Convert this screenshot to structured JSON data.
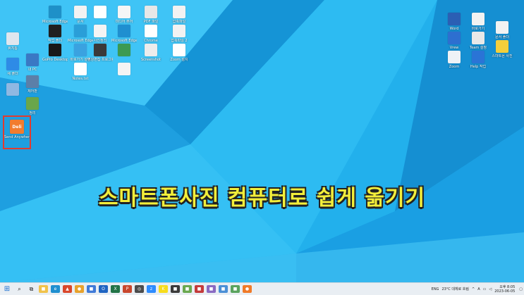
{
  "desktop": {
    "icons_left": [
      {
        "label": "휴지통",
        "color": "#dfe6ee",
        "icon": "recycle-bin-icon"
      },
      {
        "label": "새 폴더",
        "color": "#2e8be6",
        "icon": "folder-icon"
      },
      {
        "label": "",
        "color": "#8fb8e2",
        "icon": "cloud-icon"
      }
    ],
    "icons_col2": [
      {
        "label": "내 PC",
        "color": "#3a78c4",
        "icon": "pc-icon"
      },
      {
        "label": "제어판",
        "color": "#5c7fa8",
        "icon": "control-panel-icon"
      },
      {
        "label": "정리",
        "color": "#6aa64a",
        "icon": "tool-icon"
      }
    ],
    "icons_col3": [
      {
        "label": "Microsoft Edge",
        "color": "#1e90c8",
        "icon": "edge-icon"
      },
      {
        "label": "작업 폴더",
        "color": "#202020",
        "icon": "app-icon"
      },
      {
        "label": "GoPro Desktop",
        "color": "#181818",
        "icon": "camera-icon"
      }
    ],
    "icons_col4": [
      {
        "label": "문서",
        "color": "#f2f2f2",
        "icon": "document-icon"
      },
      {
        "label": "Microsoft Edge",
        "color": "#2a9ed8",
        "icon": "edge-icon"
      },
      {
        "label": "바로가기 설정",
        "color": "#3aa2e0",
        "icon": "edge-icon"
      },
      {
        "label": "Notes.txt",
        "color": "#ffffff",
        "icon": "text-file-icon"
      }
    ],
    "icons_col5": [
      {
        "label": "",
        "color": "#ffffff",
        "icon": "file-icon"
      },
      {
        "label": "사진정리",
        "color": "#f4f4f4",
        "icon": "document-icon"
      },
      {
        "label": "영상편집 프로그램",
        "color": "#3a3a3a",
        "icon": "video-icon"
      }
    ],
    "icons_col6": [
      {
        "label": "미디어 뷰어",
        "color": "#f6f6f6",
        "icon": "document-icon"
      },
      {
        "label": "Microsoft Edge",
        "color": "#1f8fd0",
        "icon": "edge-icon"
      },
      {
        "label": "",
        "color": "#3c9a52",
        "icon": "app-icon"
      },
      {
        "label": "",
        "color": "#f4f4f4",
        "icon": "zip-icon"
      }
    ],
    "icons_col7": [
      {
        "label": "PDF 파일",
        "color": "#e7e7e7",
        "icon": "pdf-icon"
      },
      {
        "label": "Chrome",
        "color": "#ffffff",
        "icon": "chrome-icon"
      },
      {
        "label": "Screenshot",
        "color": "#ececec",
        "icon": "image-icon"
      }
    ],
    "icons_col8": [
      {
        "label": "압축파일",
        "color": "#f2f2f2",
        "icon": "zip-icon"
      },
      {
        "label": "압축파일 2",
        "color": "#f2f2f2",
        "icon": "zip-icon"
      },
      {
        "label": "Zoom 설치",
        "color": "#ffffff",
        "icon": "file-icon"
      }
    ],
    "icons_right": [
      {
        "label": "Word",
        "color": "#2b5fb4",
        "icon": "word-icon"
      },
      {
        "label": "Vrew",
        "color": "#2d6fd0",
        "icon": "vrew-icon"
      },
      {
        "label": "Zoom",
        "color": "#eef2f6",
        "icon": "zoom-icon"
      }
    ],
    "icons_right2": [
      {
        "label": "바로가기",
        "color": "#f2f2f2",
        "icon": "document-icon"
      },
      {
        "label": "Team 설정",
        "color": "#e8e8e8",
        "icon": "document-icon"
      },
      {
        "label": "Help 작업",
        "color": "#2a74d6",
        "icon": "help-icon"
      }
    ],
    "icons_right3": [
      {
        "label": "문서 폴더",
        "color": "#f2f2f2",
        "icon": "document-icon"
      },
      {
        "label": "스마트폰 사진",
        "color": "#f4cf3b",
        "icon": "folder-icon"
      }
    ],
    "selected_icon": {
      "label": "Send Anywhere",
      "logo": "Deli",
      "color": "#f27c2e",
      "icon": "app-icon"
    },
    "caption": "스마트폰사진 컴퓨터로 쉽게 옮기기"
  },
  "taskbar": {
    "apps": [
      {
        "name": "file-explorer-icon",
        "color": "#f0c24a",
        "glyph": "■"
      },
      {
        "name": "edge-icon",
        "color": "#1f8fd0",
        "glyph": "e"
      },
      {
        "name": "photos-icon",
        "color": "#d9472b",
        "glyph": "▲"
      },
      {
        "name": "chrome-icon",
        "color": "#e8a22c",
        "glyph": "●"
      },
      {
        "name": "store-icon",
        "color": "#3f7ad8",
        "glyph": "■"
      },
      {
        "name": "outlook-icon",
        "color": "#1f64c2",
        "glyph": "O"
      },
      {
        "name": "excel-icon",
        "color": "#217346",
        "glyph": "X"
      },
      {
        "name": "powerpoint-icon",
        "color": "#c8472d",
        "glyph": "P"
      },
      {
        "name": "search-app-icon",
        "color": "#4c4c4c",
        "glyph": "◎"
      },
      {
        "name": "zoom-icon",
        "color": "#2d8cff",
        "glyph": "z"
      },
      {
        "name": "kakao-icon",
        "color": "#f7dc1c",
        "glyph": "K"
      },
      {
        "name": "app-icon",
        "color": "#3a3a3a",
        "glyph": "■"
      },
      {
        "name": "photos-app-icon",
        "color": "#6aa84f",
        "glyph": "■"
      },
      {
        "name": "capture-icon",
        "color": "#c43b3b",
        "glyph": "■"
      },
      {
        "name": "gallery-icon",
        "color": "#8a6ac2",
        "glyph": "■"
      },
      {
        "name": "settings-app-icon",
        "color": "#4b8fd6",
        "glyph": "■"
      },
      {
        "name": "tool-app-icon",
        "color": "#5aa35e",
        "glyph": "■"
      },
      {
        "name": "orange-app-icon",
        "color": "#f07a28",
        "glyph": "●"
      }
    ],
    "tray": {
      "lang": "ENG",
      "weather": "23°C 대체로 흐림",
      "ime": "A",
      "time": "오후 8:05",
      "date": "2023-06-05"
    }
  }
}
